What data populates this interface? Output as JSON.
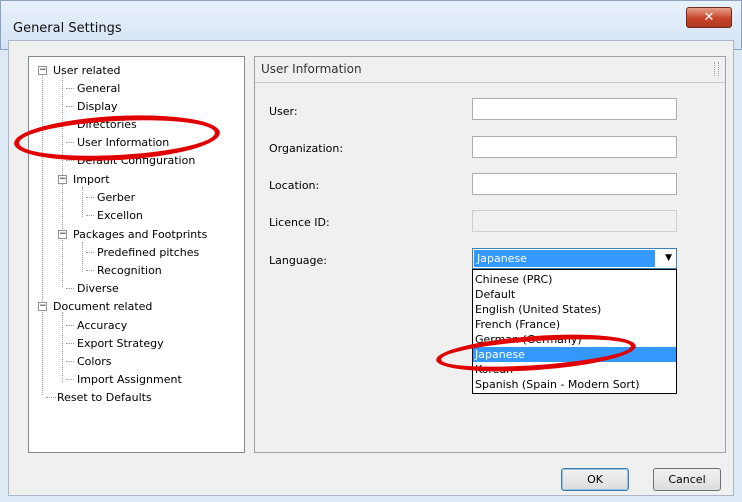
{
  "window": {
    "title": "General Settings",
    "close_glyph": "✕"
  },
  "tree": {
    "items": [
      {
        "label": "User related",
        "expander": "−"
      },
      {
        "label": "General"
      },
      {
        "label": "Display"
      },
      {
        "label": "Directories"
      },
      {
        "label": "User Information"
      },
      {
        "label": "Default Configuration"
      },
      {
        "label": "Import",
        "expander": "−"
      },
      {
        "label": "Gerber"
      },
      {
        "label": "Excellon"
      },
      {
        "label": "Packages and Footprints",
        "expander": "−"
      },
      {
        "label": "Predefined pitches"
      },
      {
        "label": "Recognition"
      },
      {
        "label": "Diverse"
      },
      {
        "label": "Document related",
        "expander": "−"
      },
      {
        "label": "Accuracy"
      },
      {
        "label": "Export Strategy"
      },
      {
        "label": "Colors"
      },
      {
        "label": "Import Assignment"
      },
      {
        "label": "Reset to Defaults"
      }
    ]
  },
  "panel": {
    "title": "User Information",
    "fields": {
      "user": {
        "label": "User:",
        "value": ""
      },
      "organization": {
        "label": "Organization:",
        "value": ""
      },
      "location": {
        "label": "Location:",
        "value": ""
      },
      "licence": {
        "label": "Licence ID:",
        "value": ""
      },
      "language": {
        "label": "Language:",
        "value": "Japanese"
      }
    },
    "language_options": [
      "Chinese (PRC)",
      "Default",
      "English (United States)",
      "French (France)",
      "German (Germany)",
      "Japanese",
      "Korean",
      "Spanish (Spain - Modern Sort)"
    ],
    "selected_language_index": 5
  },
  "buttons": {
    "ok": "OK",
    "cancel": "Cancel"
  },
  "colors": {
    "annotation": "#e00000",
    "selection": "#3399ff"
  }
}
